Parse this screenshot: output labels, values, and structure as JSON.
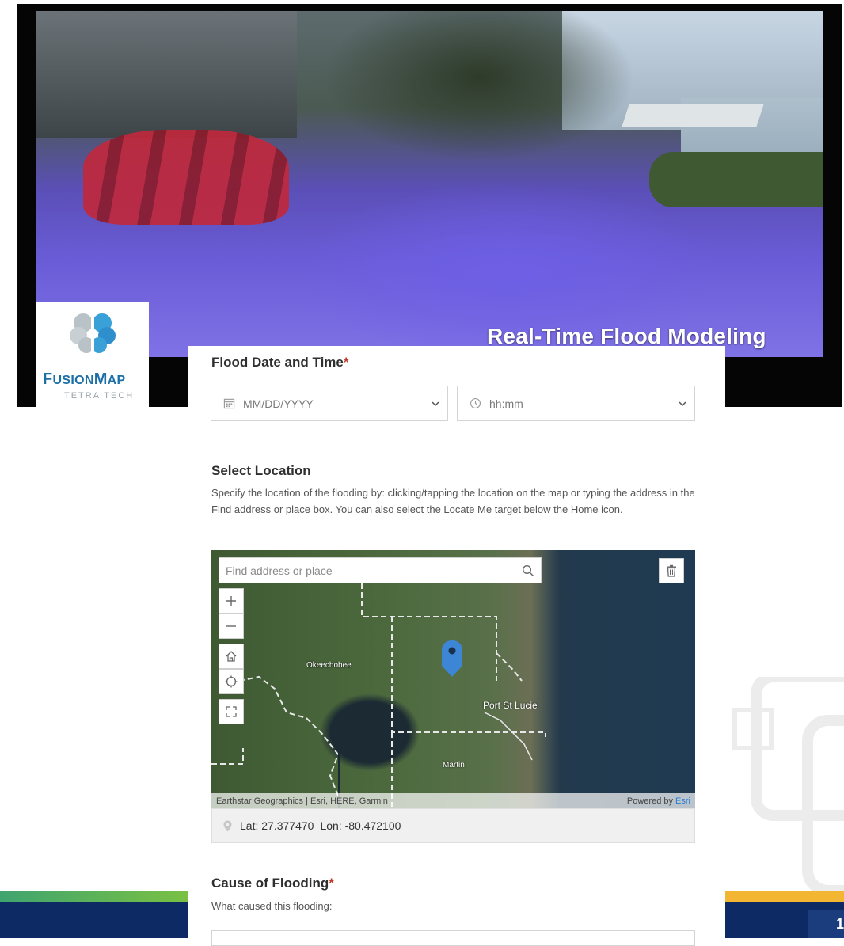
{
  "slide": {
    "hero_title": "Real-Time Flood Modeling",
    "logo": {
      "name_big": "F",
      "name_rest": "USION",
      "name_big2": "M",
      "name_rest2": "AP",
      "subtitle": "TETRA TECH"
    },
    "page_number": "1",
    "colors": {
      "brand_blue": "#1c6fa6",
      "navy": "#0d2a64",
      "flood": "#6a5cd6",
      "gold": "#f2b632",
      "green": "#7ac143"
    }
  },
  "form": {
    "datetime": {
      "label": "Flood Date and Time",
      "required_mark": "*",
      "date_placeholder": "MM/DD/YYYY",
      "time_placeholder": "hh:mm"
    },
    "location": {
      "label": "Select Location",
      "description": "Specify the location of the flooding by: clicking/tapping the location on the map or typing the address in the Find address or place box. You can also select the Locate Me target below the Home icon.",
      "map": {
        "search_placeholder": "Find address or place",
        "place_labels": {
          "okeechobee": "Okeechobee",
          "port_st_lucie": "Port St Lucie",
          "martin": "Martin"
        },
        "attribution": "Earthstar Geographics | Esri, HERE, Garmin",
        "powered_by": "Powered by",
        "esri": "Esri"
      },
      "coords": {
        "lat_label": "Lat:",
        "lat": "27.377470",
        "lon_label": "Lon:",
        "lon": "-80.472100"
      }
    },
    "cause": {
      "label": "Cause of Flooding",
      "required_mark": "*",
      "description": "What caused this flooding:"
    }
  }
}
